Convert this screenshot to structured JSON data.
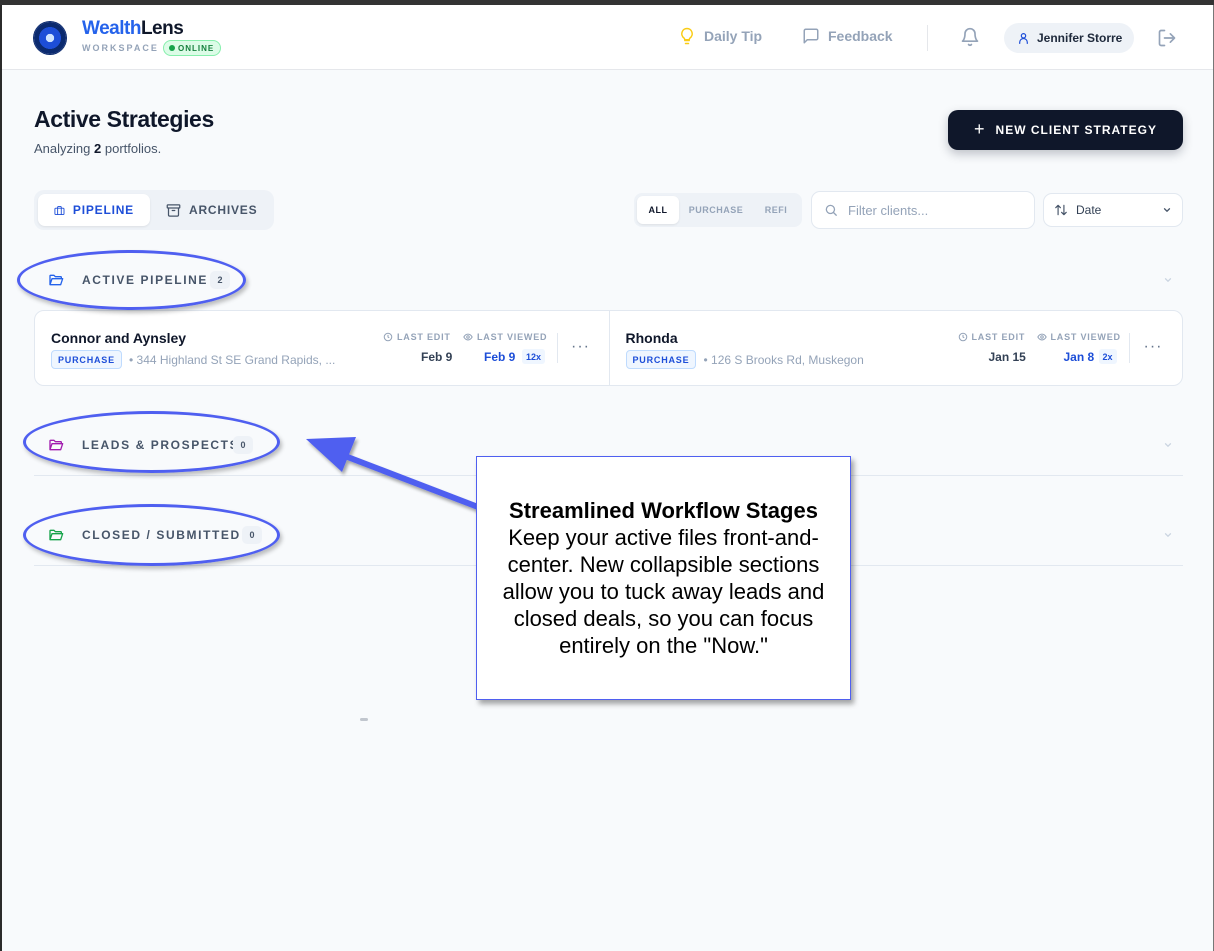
{
  "brand": {
    "name_part1": "Wealth",
    "name_part2": "Lens",
    "workspace_label": "WORKSPACE",
    "status_badge": "ONLINE"
  },
  "header": {
    "daily_tip_label": "Daily Tip",
    "feedback_label": "Feedback",
    "user_name": "Jennifer Storre",
    "icons": [
      "lightbulb-icon",
      "chat-icon",
      "bell-icon",
      "user-icon",
      "logout-icon"
    ]
  },
  "page": {
    "title": "Active Strategies",
    "subtitle_prefix": "Analyzing",
    "portfolio_count": "2",
    "subtitle_suffix": "portfolios.",
    "new_button_label": "NEW CLIENT STRATEGY"
  },
  "view_tabs": [
    {
      "label": "PIPELINE",
      "active": true
    },
    {
      "label": "ARCHIVES",
      "active": false
    }
  ],
  "filters": {
    "segments": [
      "ALL",
      "PURCHASE",
      "REFI"
    ],
    "selected": "ALL",
    "search_placeholder": "Filter clients...",
    "sort_value": "Date"
  },
  "sections": [
    {
      "label": "ACTIVE PIPELINE",
      "count": "2",
      "color": "#2563eb"
    },
    {
      "label": "LEADS & PROSPECTS",
      "count": "0",
      "color": "#a21caf"
    },
    {
      "label": "CLOSED / SUBMITTED",
      "count": "0",
      "color": "#16a34a"
    }
  ],
  "clients": [
    {
      "name": "Connor and Aynsley",
      "type": "PURCHASE",
      "address": "• 344 Highland St SE Grand Rapids, ...",
      "last_edit_label": "LAST EDIT",
      "last_edit": "Feb 9",
      "last_viewed_label": "LAST VIEWED",
      "last_viewed": "Feb 9",
      "view_count": "12x",
      "more": "···"
    },
    {
      "name": "Rhonda",
      "type": "PURCHASE",
      "address": "• 126 S Brooks Rd, Muskegon",
      "last_edit_label": "LAST EDIT",
      "last_edit": "Jan 15",
      "last_viewed_label": "LAST VIEWED",
      "last_viewed": "Jan 8",
      "view_count": "2x",
      "more": "···"
    }
  ],
  "callout": {
    "title": "Streamlined Workflow Stages",
    "body": "Keep your active files front-and-center. New collapsible sections allow you to tuck away leads and closed deals, so you can focus entirely on the \"Now.\""
  },
  "colors": {
    "accent": "#1d4ed8",
    "dark": "#0f172a",
    "annotation": "#4f5ff0",
    "online": "#16a34a"
  }
}
